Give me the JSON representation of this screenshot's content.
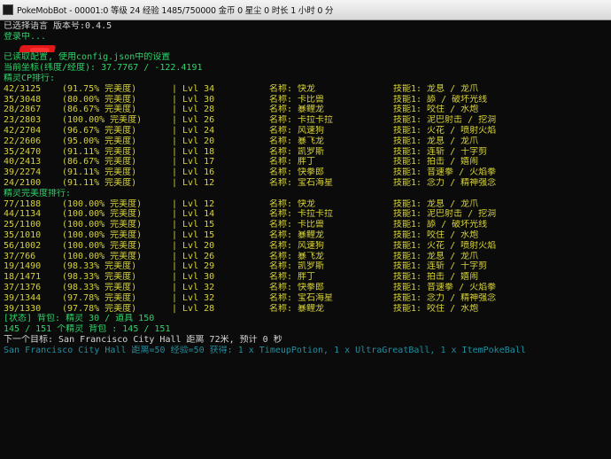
{
  "window": {
    "title": "PokeMobBot - 00001:0 等级 24 经验 1485/750000 金币 0 星尘 0 时长 1 小时 0 分",
    "icon": "console-app-icon"
  },
  "console": {
    "header_lines": [
      {
        "text": "已选择语言 版本号:0.4.5",
        "color": "white"
      },
      {
        "text": "登录中...",
        "color": "green"
      },
      {
        "text": "",
        "color": "green",
        "redacted": true
      },
      {
        "text": "已读取配置, 使用config.json中的设置",
        "color": "green"
      },
      {
        "text": "当前坐标(纬度/经度): 37.7767 / -122.4191",
        "color": "green"
      },
      {
        "text": "精灵CP排行:",
        "color": "green"
      }
    ],
    "cp_rows": [
      {
        "cp": "42/3125",
        "iv": "(91.75% 完美度)",
        "lvl": "Lvl 34",
        "name": "名称: 快龙",
        "moves": "技能1: 龙息 / 龙爪"
      },
      {
        "cp": "35/3048",
        "iv": "(80.00% 完美度)",
        "lvl": "Lvl 30",
        "name": "名称: 卡比兽",
        "moves": "技能1: 舔 / 破坏光线"
      },
      {
        "cp": "28/2867",
        "iv": "(86.67% 完美度)",
        "lvl": "Lvl 28",
        "name": "名称: 暴鲤龙",
        "moves": "技能1: 咬住 / 水炮"
      },
      {
        "cp": "23/2803",
        "iv": "(100.00% 完美度)",
        "lvl": "Lvl 26",
        "name": "名称: 卡拉卡拉",
        "moves": "技能1: 泥巴射击 / 挖洞"
      },
      {
        "cp": "42/2704",
        "iv": "(96.67% 完美度)",
        "lvl": "Lvl 24",
        "name": "名称: 风速狗",
        "moves": "技能1: 火花 / 喷射火焰"
      },
      {
        "cp": "22/2606",
        "iv": "(95.00% 完美度)",
        "lvl": "Lvl 20",
        "name": "名称: 暴飞龙",
        "moves": "技能1: 龙息 / 龙爪"
      },
      {
        "cp": "35/2470",
        "iv": "(91.11% 完美度)",
        "lvl": "Lvl 18",
        "name": "名称: 凯罗斯",
        "moves": "技能1: 连斩 / 十字剪"
      },
      {
        "cp": "40/2413",
        "iv": "(86.67% 完美度)",
        "lvl": "Lvl 17",
        "name": "名称: 胖丁",
        "moves": "技能1: 拍击 / 嬉闹"
      },
      {
        "cp": "39/2274",
        "iv": "(91.11% 完美度)",
        "lvl": "Lvl 16",
        "name": "名称: 快拳郎",
        "moves": "技能1: 音速拳 / 火焰拳"
      },
      {
        "cp": "24/2100",
        "iv": "(91.11% 完美度)",
        "lvl": "Lvl 12",
        "name": "名称: 宝石海星",
        "moves": "技能1: 念力 / 精神强念"
      }
    ],
    "iv_header": {
      "text": "精灵完美度排行:",
      "color": "green"
    },
    "iv_rows": [
      {
        "cp": "77/1188",
        "iv": "(100.00% 完美度)",
        "lvl": "Lvl 12",
        "name": "名称: 快龙",
        "moves": "技能1: 龙息 / 龙爪"
      },
      {
        "cp": "44/1134",
        "iv": "(100.00% 完美度)",
        "lvl": "Lvl 14",
        "name": "名称: 卡拉卡拉",
        "moves": "技能1: 泥巴射击 / 挖洞"
      },
      {
        "cp": "25/1100",
        "iv": "(100.00% 完美度)",
        "lvl": "Lvl 15",
        "name": "名称: 卡比兽",
        "moves": "技能1: 舔 / 破坏光线"
      },
      {
        "cp": "35/1010",
        "iv": "(100.00% 完美度)",
        "lvl": "Lvl 15",
        "name": "名称: 暴鲤龙",
        "moves": "技能1: 咬住 / 水炮"
      },
      {
        "cp": "56/1002",
        "iv": "(100.00% 完美度)",
        "lvl": "Lvl 20",
        "name": "名称: 风速狗",
        "moves": "技能1: 火花 / 喷射火焰"
      },
      {
        "cp": "37/766",
        "iv": "(100.00% 完美度)",
        "lvl": "Lvl 26",
        "name": "名称: 暴飞龙",
        "moves": "技能1: 龙息 / 龙爪"
      },
      {
        "cp": "19/1490",
        "iv": "(98.33% 完美度)",
        "lvl": "Lvl 29",
        "name": "名称: 凯罗斯",
        "moves": "技能1: 连斩 / 十字剪"
      },
      {
        "cp": "18/1471",
        "iv": "(98.33% 完美度)",
        "lvl": "Lvl 30",
        "name": "名称: 胖丁",
        "moves": "技能1: 拍击 / 嬉闹"
      },
      {
        "cp": "37/1376",
        "iv": "(98.33% 完美度)",
        "lvl": "Lvl 32",
        "name": "名称: 快拳郎",
        "moves": "技能1: 音速拳 / 火焰拳"
      },
      {
        "cp": "39/1344",
        "iv": "(97.78% 完美度)",
        "lvl": "Lvl 32",
        "name": "名称: 宝石海星",
        "moves": "技能1: 念力 / 精神强念"
      },
      {
        "cp": "39/1330",
        "iv": "(97.78% 完美度)",
        "lvl": "Lvl 28",
        "name": "名称: 暴鲤龙",
        "moves": "技能1: 咬住 / 水炮"
      }
    ],
    "footer_lines": [
      {
        "text": "[状态] 背包: 精灵 30 / 道具 150",
        "color": "green"
      },
      {
        "text": "145 / 151 个精灵 背包 : 145 / 151",
        "color": "green"
      },
      {
        "text": "下一个目标: San Francisco City Hall 距离 72米, 预计 0 秒",
        "color": "white"
      },
      {
        "text": "San Francisco City Hall 距离=50 经验=50 获得: 1 x TimeupPotion, 1 x UltraGreatBall, 1 x ItemPokeBall",
        "color": "teal"
      }
    ]
  }
}
